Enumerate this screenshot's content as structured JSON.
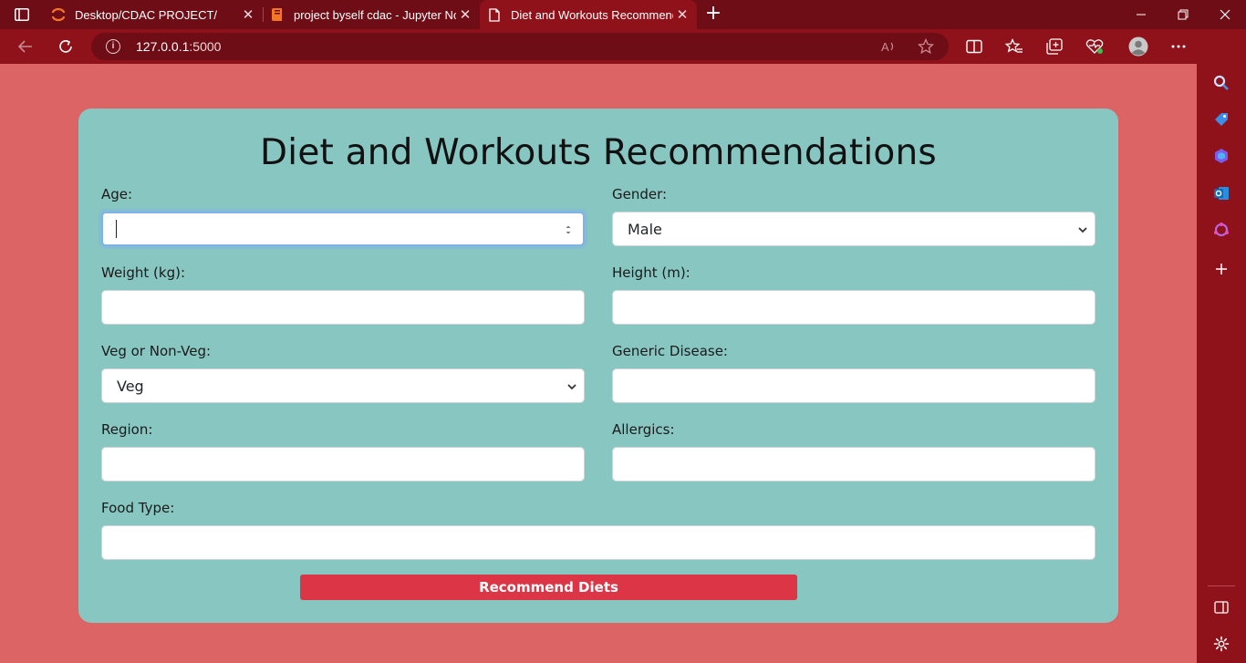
{
  "browser": {
    "tabs": [
      {
        "title": "Desktop/CDAC PROJECT/",
        "active": false
      },
      {
        "title": "project byself cdac - Jupyter Note",
        "active": false
      },
      {
        "title": "Diet and Workouts Recommenda",
        "active": true
      }
    ],
    "url_host": "127.0.0.1",
    "url_port": ":5000"
  },
  "form": {
    "title": "Diet and Workouts Recommendations",
    "age": {
      "label": "Age:",
      "value": ""
    },
    "gender": {
      "label": "Gender:",
      "selected": "Male"
    },
    "weight": {
      "label": "Weight (kg):",
      "value": ""
    },
    "height": {
      "label": "Height (m):",
      "value": ""
    },
    "veg": {
      "label": "Veg or Non-Veg:",
      "selected": "Veg"
    },
    "disease": {
      "label": "Generic Disease:",
      "value": ""
    },
    "region": {
      "label": "Region:",
      "value": ""
    },
    "allergics": {
      "label": "Allergics:",
      "value": ""
    },
    "food_type": {
      "label": "Food Type:",
      "value": ""
    },
    "submit_label": "Recommend Diets"
  },
  "colors": {
    "page_bg": "#dd6464",
    "card_bg": "#88c6c2",
    "button": "#dc3545",
    "chrome": "#8f1119"
  }
}
